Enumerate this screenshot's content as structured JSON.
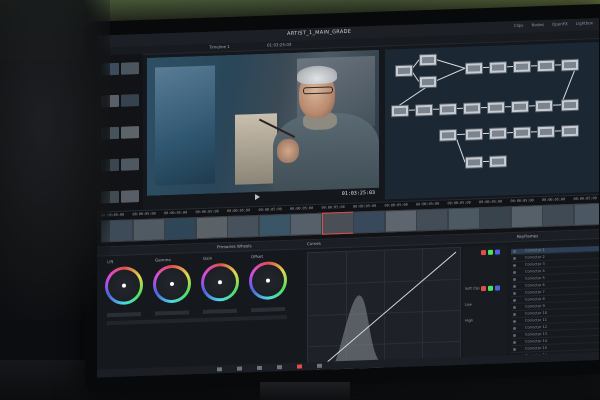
{
  "app": {
    "project_title": "ARTIST_1_MAIN_GRADE",
    "top_tools": [
      "Clips",
      "Nodes",
      "OpenFX",
      "Lightbox"
    ],
    "viewer_label": "Timeline 1",
    "timecode": "01:03:25:03"
  },
  "timeline": {
    "clips": [
      {
        "tc": "00:00:05:00"
      },
      {
        "tc": "00:00:05:00"
      },
      {
        "tc": "00:00:05:00"
      },
      {
        "tc": "00:00:05:00"
      },
      {
        "tc": "00:00:05:00"
      },
      {
        "tc": "00:00:05:00"
      },
      {
        "tc": "00:00:05:00"
      },
      {
        "tc": "00:00:05:00"
      },
      {
        "tc": "00:00:05:00"
      },
      {
        "tc": "00:00:05:00"
      },
      {
        "tc": "00:00:05:00"
      },
      {
        "tc": "00:00:05:00"
      },
      {
        "tc": "00:00:05:00"
      },
      {
        "tc": "00:00:05:00"
      },
      {
        "tc": "00:00:05:00"
      },
      {
        "tc": "00:00:05:00"
      }
    ]
  },
  "color_panel": {
    "wheels_tab": "Primaries Wheels",
    "curves_tab": "Curves",
    "keyframes_tab": "Keyframes",
    "wheels": [
      {
        "label": "Lift"
      },
      {
        "label": "Gamma"
      },
      {
        "label": "Gain"
      },
      {
        "label": "Offset"
      }
    ],
    "channel_labels": [
      "Soft Clip",
      "Low",
      "High"
    ],
    "keyframe_rows": [
      "Corrector 1",
      "Corrector 2",
      "Corrector 3",
      "Corrector 4",
      "Corrector 5",
      "Corrector 6",
      "Corrector 7",
      "Corrector 8",
      "Corrector 9",
      "Corrector 10",
      "Corrector 11",
      "Corrector 12",
      "Corrector 13",
      "Corrector 14",
      "Corrector 15",
      "Corrector 16"
    ]
  },
  "colors": {
    "accent": "#e14d4d",
    "curve": "#d7dbdf"
  }
}
